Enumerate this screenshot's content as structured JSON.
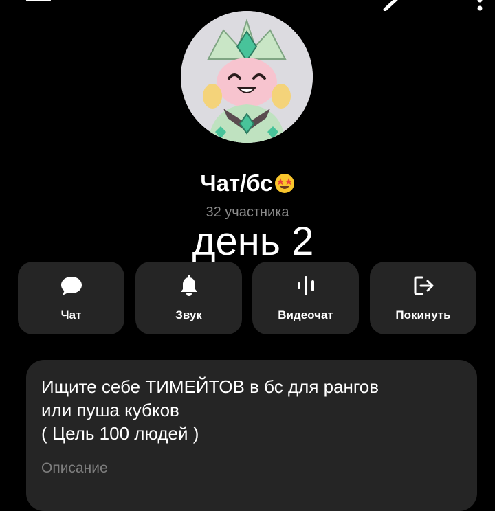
{
  "header": {
    "back_icon": "arrow-left-icon",
    "edit_icon": "pencil-icon",
    "more_icon": "more-vertical-icon"
  },
  "group": {
    "title": "Чат/бс",
    "title_emoji": "star-struck-emoji",
    "members": "32 участника"
  },
  "overlay": {
    "caption": "день 2"
  },
  "actions": [
    {
      "label": "Чат",
      "icon": "chat-bubble-icon"
    },
    {
      "label": "Звук",
      "icon": "bell-icon"
    },
    {
      "label": "Видеочат",
      "icon": "audio-waveform-icon"
    },
    {
      "label": "Покинуть",
      "icon": "exit-icon"
    }
  ],
  "description": {
    "lines": [
      "Ищите себе ТИМЕЙТОВ в бс для рангов",
      "или пуша кубков",
      "( Цель 100 людей )"
    ],
    "label": "Описание"
  },
  "colors": {
    "background": "#000000",
    "card": "#252525",
    "secondary_text": "#8a8a8a"
  }
}
